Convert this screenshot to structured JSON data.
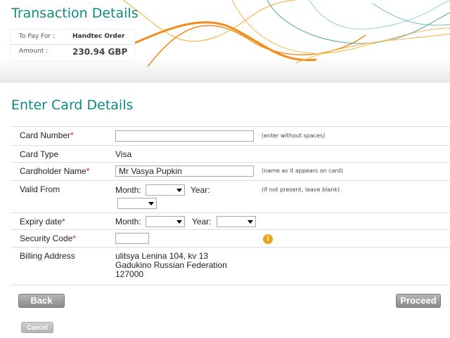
{
  "transaction": {
    "title": "Transaction Details",
    "to_pay_for_label": "To Pay For :",
    "to_pay_for_value": "Handtec Order",
    "amount_label": "Amount :",
    "amount_value": "230.94 GBP"
  },
  "card": {
    "title": "Enter Card Details",
    "card_number": {
      "label": "Card Number",
      "value": "",
      "hint": "(enter without spaces)"
    },
    "card_type": {
      "label": "Card Type",
      "value": "Visa"
    },
    "cardholder": {
      "label": "Cardholder Name",
      "value": "Mr Vasya Pupkin",
      "hint": "(name as it appears on card)"
    },
    "valid_from": {
      "label": "Valid From",
      "month_label": "Month:",
      "year_label": "Year:",
      "hint": "(if not present, leave blank)"
    },
    "expiry": {
      "label": "Expiry date",
      "month_label": "Month:",
      "year_label": "Year:"
    },
    "security_code": {
      "label": "Security Code",
      "value": ""
    },
    "billing_address": {
      "label": "Billing Address",
      "line1": "ulitsya Lenina 104, kv 13",
      "line2": "Gadukino Russian Federation",
      "line3": "127000"
    }
  },
  "buttons": {
    "back": "Back",
    "proceed": "Proceed",
    "cancel": "Cancel"
  },
  "icons": {
    "info": "info-icon"
  },
  "colors": {
    "heading": "#0c8a82",
    "required": "#d02020",
    "info": "#e7a520",
    "decor_orange": "#f08c1a"
  }
}
